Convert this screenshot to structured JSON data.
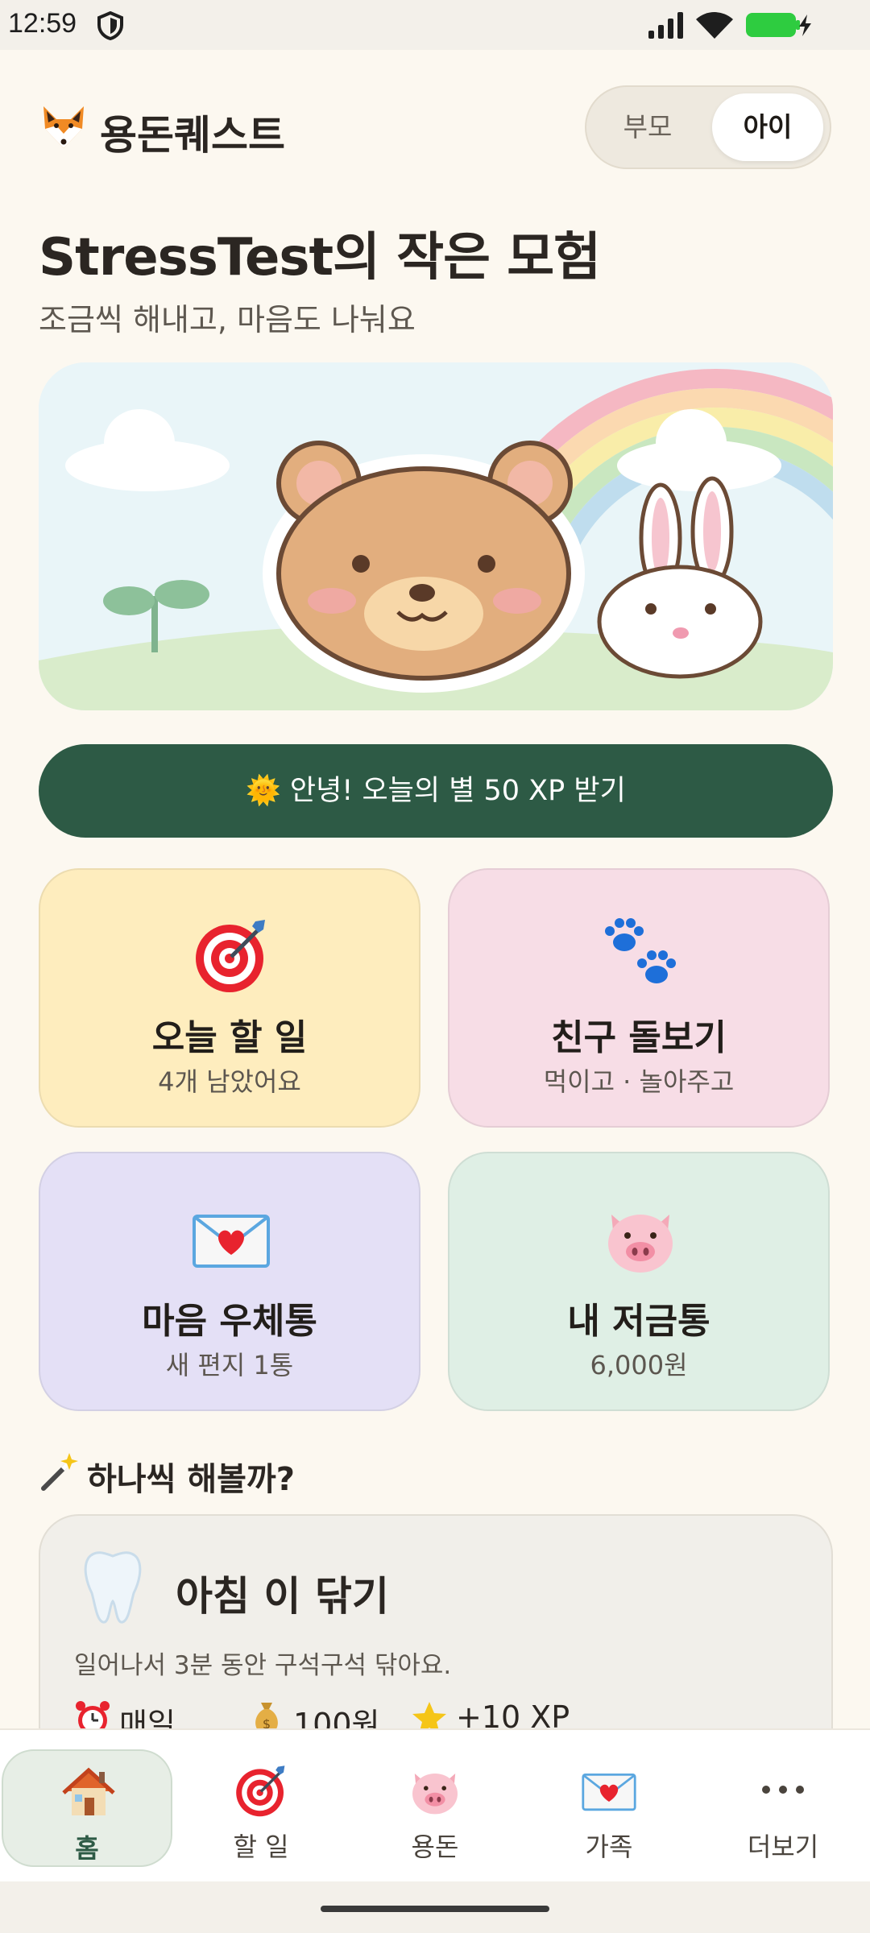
{
  "status_bar": {
    "time": "12:59",
    "battery_color": "#2ECC40"
  },
  "header": {
    "app_name": "용돈퀘스트",
    "logo_icon": "fox-icon"
  },
  "mode_toggle": {
    "options": [
      "부모",
      "아이"
    ],
    "selected": "아이"
  },
  "main": {
    "title": "StressTest의 작은 모험",
    "subtitle": "조금씩 해내고, 마음도 나눠요",
    "cta_label": "🌞 안녕! 오늘의 별 50 XP 받기",
    "cta_color": "#2D5A45"
  },
  "cards": [
    {
      "title": "오늘 할 일",
      "subtitle": "4개 남았어요",
      "icon": "target-icon",
      "color": "#FEEDBE"
    },
    {
      "title": "친구 돌보기",
      "subtitle": "먹이고 · 놀아주고",
      "icon": "paw-prints-icon",
      "color": "#F7DDE6"
    },
    {
      "title": "마음 우체통",
      "subtitle": "새 편지 1통",
      "icon": "love-letter-icon",
      "color": "#E4E0F6"
    },
    {
      "title": "내 저금통",
      "subtitle": "6,000원",
      "icon": "pig-icon",
      "color": "#DFEFE5"
    }
  ],
  "section": {
    "title": "하나씩 해볼까?",
    "icon": "magic-wand-icon"
  },
  "task": {
    "title": "아침 이 닦기",
    "description": "일어나서 3분 동안 구석구석 닦아요.",
    "repeat": "매일",
    "reward": "100원",
    "xp": "+10 XP"
  },
  "bottom_nav": {
    "items": [
      {
        "label": "홈",
        "icon": "house-icon",
        "active": true
      },
      {
        "label": "할 일",
        "icon": "target-icon",
        "active": false
      },
      {
        "label": "용돈",
        "icon": "pig-icon",
        "active": false
      },
      {
        "label": "가족",
        "icon": "love-letter-icon",
        "active": false
      },
      {
        "label": "더보기",
        "icon": "more-dots-icon",
        "active": false
      }
    ]
  }
}
